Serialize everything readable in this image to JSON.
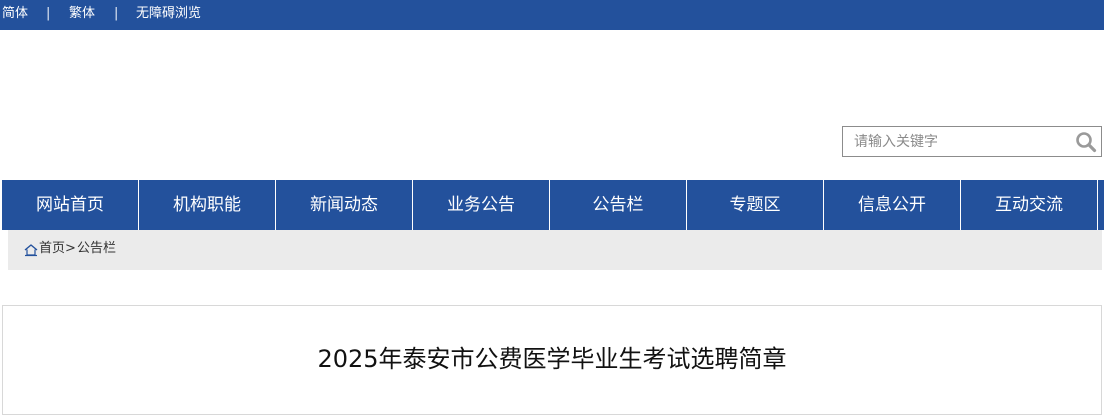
{
  "topbar": {
    "simplified": "简体",
    "separator": "|",
    "traditional": "繁体",
    "accessible": "无障碍浏览"
  },
  "search": {
    "placeholder": "请输入关键字",
    "icon": "search-icon"
  },
  "nav": {
    "items": [
      "网站首页",
      "机构职能",
      "新闻动态",
      "业务公告",
      "公告栏",
      "专题区",
      "信息公开",
      "互动交流"
    ]
  },
  "breadcrumb": {
    "icon": "home-icon",
    "home": "首页",
    "separator": ">",
    "current": "公告栏"
  },
  "article": {
    "title": "2025年泰安市公费医学毕业生考试选聘简章"
  },
  "colors": {
    "brand_blue": "#23519c",
    "breadcrumb_bg": "#ebebeb"
  }
}
